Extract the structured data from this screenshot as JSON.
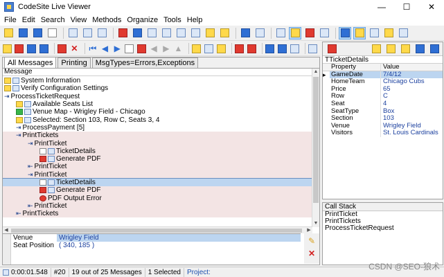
{
  "window": {
    "title": "CodeSite Live Viewer",
    "minimize": "—",
    "maximize": "☐",
    "close": "✕"
  },
  "menu": [
    "File",
    "Edit",
    "Search",
    "View",
    "Methods",
    "Organize",
    "Tools",
    "Help"
  ],
  "tabs": [
    "All Messages",
    "Printing",
    "MsgTypes=Errors,Exceptions"
  ],
  "messages_header": "Message",
  "messages": [
    {
      "text": "System Information",
      "icon": "info-icon",
      "indent": 0,
      "marker": "y",
      "pink": false
    },
    {
      "text": "Verify Configuration Settings",
      "icon": "warning-icon",
      "indent": 0,
      "marker": "y",
      "pink": false
    },
    {
      "text": "ProcessTicketRequest",
      "icon": "enter-method-icon",
      "indent": 0,
      "marker": "",
      "pink": false
    },
    {
      "text": "Available Seats List",
      "icon": "list-icon",
      "indent": 1,
      "marker": "y",
      "pink": false
    },
    {
      "text": "Venue Map - Wrigley Field - Chicago",
      "icon": "image-icon",
      "indent": 1,
      "marker": "g",
      "pink": false
    },
    {
      "text": "Selected: Section 103, Row C, Seats 3, 4",
      "icon": "note-icon",
      "indent": 1,
      "marker": "y",
      "pink": false
    },
    {
      "text": "ProcessPayment  [5]",
      "icon": "collapsed-method-icon",
      "indent": 1,
      "marker": "",
      "pink": false
    },
    {
      "text": "PrintTickets",
      "icon": "enter-method-icon",
      "indent": 1,
      "marker": "",
      "pink": true
    },
    {
      "text": "PrintTicket",
      "icon": "enter-method-icon",
      "indent": 2,
      "marker": "",
      "pink": true
    },
    {
      "text": "TicketDetails",
      "icon": "object-icon",
      "indent": 3,
      "marker": "w",
      "pink": true
    },
    {
      "text": "Generate PDF",
      "icon": "document-icon",
      "indent": 3,
      "marker": "r",
      "pink": true
    },
    {
      "text": "PrintTicket",
      "icon": "exit-method-icon",
      "indent": 2,
      "marker": "",
      "pink": true
    },
    {
      "text": "PrintTicket",
      "icon": "enter-method-icon",
      "indent": 2,
      "marker": "",
      "pink": true
    },
    {
      "text": "TicketDetails",
      "icon": "object-icon",
      "indent": 3,
      "marker": "w",
      "pink": false,
      "selected": true
    },
    {
      "text": "Generate PDF",
      "icon": "document-icon",
      "indent": 3,
      "marker": "r",
      "pink": true
    },
    {
      "text": "PDF Output Error",
      "icon": "error-icon",
      "indent": 3,
      "marker": "",
      "pink": true
    },
    {
      "text": "PrintTicket",
      "icon": "exit-method-icon",
      "indent": 2,
      "marker": "",
      "pink": true
    },
    {
      "text": "PrintTickets",
      "icon": "exit-method-icon",
      "indent": 1,
      "marker": "",
      "pink": true
    }
  ],
  "detail": [
    {
      "name": "Venue",
      "value": "Wrigley Field"
    },
    {
      "name": "Seat Position",
      "value": "( 340, 185 )"
    },
    {
      "name": "",
      "value": ""
    },
    {
      "name": "",
      "value": ""
    }
  ],
  "inspector": {
    "title": "TTicketDetails",
    "col_property": "Property",
    "col_value": "Value",
    "rows": [
      {
        "property": "GameDate",
        "value": "7/4/12",
        "selected": true
      },
      {
        "property": "HomeTeam",
        "value": "Chicago Cubs"
      },
      {
        "property": "Price",
        "value": "65"
      },
      {
        "property": "Row",
        "value": "C"
      },
      {
        "property": "Seat",
        "value": "4"
      },
      {
        "property": "SeatType",
        "value": "Box"
      },
      {
        "property": "Section",
        "value": "103"
      },
      {
        "property": "Venue",
        "value": "Wrigley Field"
      },
      {
        "property": "Visitors",
        "value": "St. Louis Cardinals"
      }
    ]
  },
  "callstack": {
    "header": "Call Stack",
    "items": [
      "PrintTicket",
      "PrintTickets",
      "ProcessTicketRequest"
    ]
  },
  "status": {
    "time": "0:00:01.548",
    "msg_number": "#20",
    "count": "19 out of 25 Messages",
    "selected": "1 Selected",
    "project": "Project:"
  },
  "watermark": "CSDN @SEO-狼术"
}
